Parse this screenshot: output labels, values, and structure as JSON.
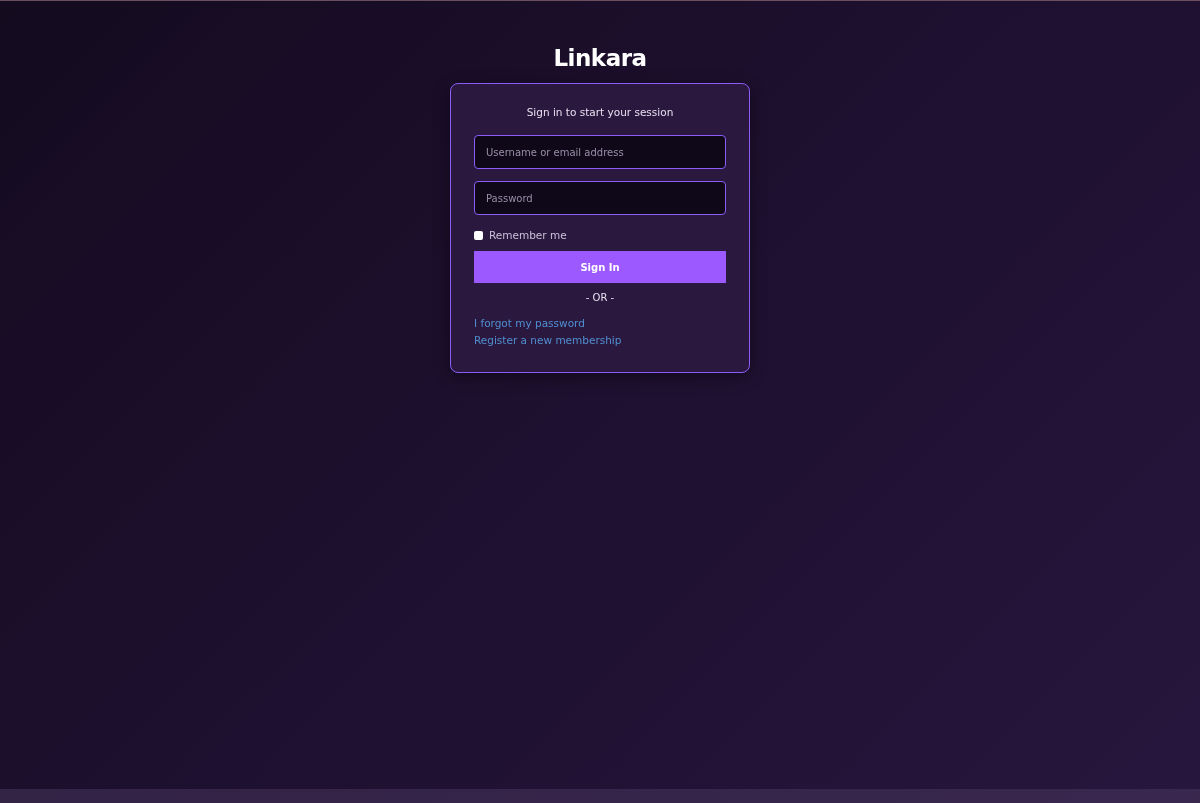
{
  "logo": "Linkara",
  "card": {
    "title": "Sign in to start your session",
    "fields": [
      {
        "placeholder": "Username or email address"
      },
      {
        "placeholder": "Password"
      }
    ],
    "remember": {
      "label": "Remember me",
      "checked": false
    },
    "button": "Sign In",
    "divider": "- OR -",
    "links": [
      "I forgot my password",
      "Register a new membership"
    ]
  }
}
